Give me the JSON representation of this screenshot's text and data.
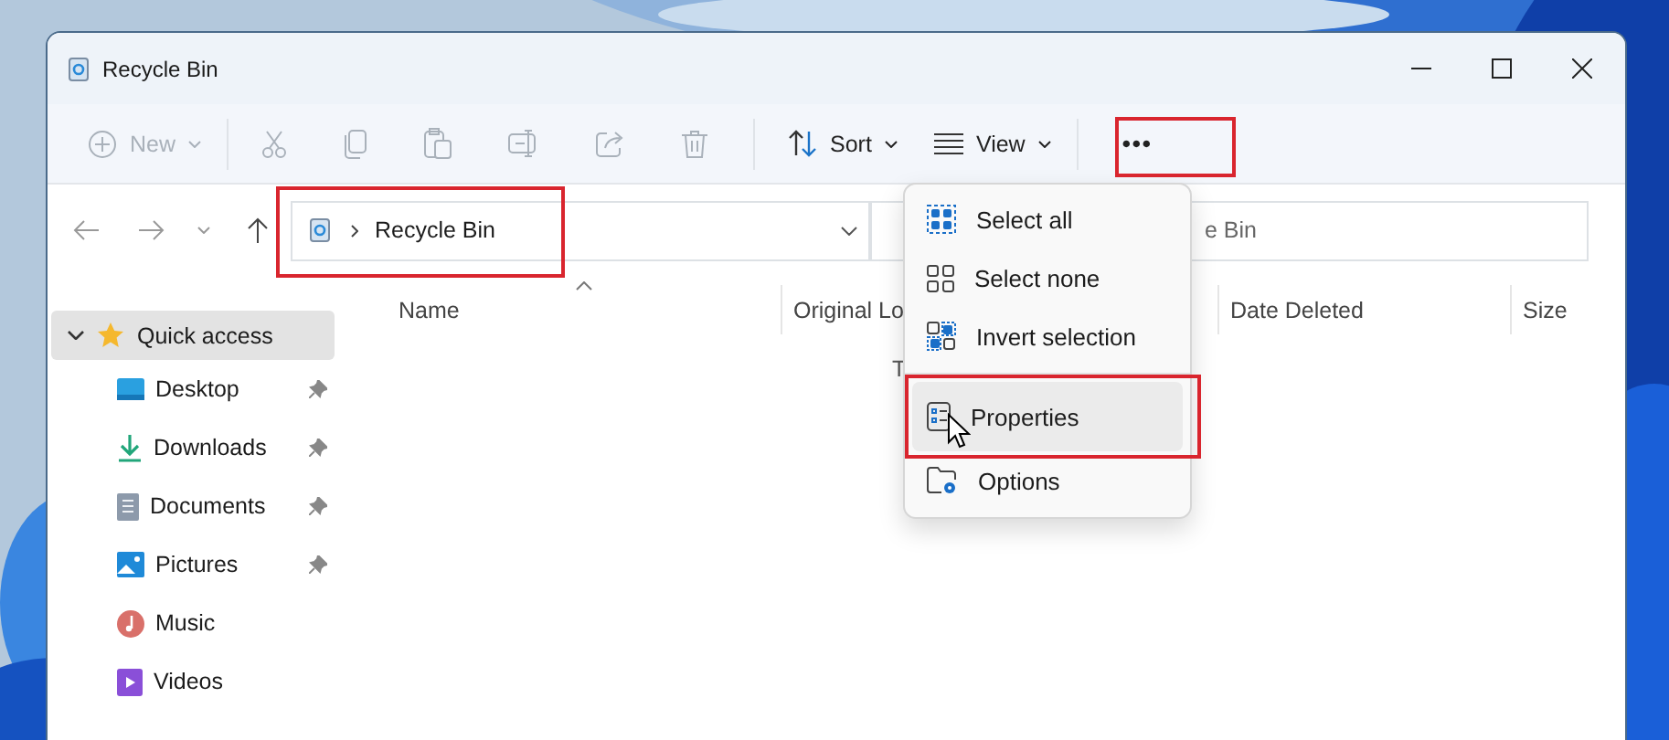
{
  "window": {
    "title": "Recycle Bin"
  },
  "toolbar": [
    {
      "label": "New",
      "disabled": true
    },
    {
      "disabled": true
    },
    {
      "disabled": true
    },
    {
      "disabled": true
    },
    {
      "disabled": true
    },
    {
      "disabled": true
    },
    {
      "disabled": true
    },
    {
      "label": "Sort",
      "disabled": false
    },
    {
      "label": "View",
      "disabled": false
    },
    {
      "label": "•••",
      "disabled": false,
      "highlighted": true
    }
  ],
  "address_bar": {
    "path": "Recycle Bin",
    "highlighted": true
  },
  "search": {
    "placeholder": "e Bin"
  },
  "columns": [
    {
      "label": "Name",
      "sorted": true
    },
    {
      "label": "Original Lo"
    },
    {
      "label": "Date Deleted"
    },
    {
      "label": "Size"
    }
  ],
  "empty_message": "T",
  "sidebar": {
    "items": [
      {
        "label": "Quick access",
        "selected": true,
        "expanded": true,
        "children": [
          {
            "label": "Desktop",
            "selected": false,
            "pinned": true
          },
          {
            "label": "Downloads",
            "selected": false,
            "pinned": true
          },
          {
            "label": "Documents",
            "selected": false,
            "pinned": true
          },
          {
            "label": "Pictures",
            "selected": false,
            "pinned": true
          },
          {
            "label": "Music",
            "selected": false,
            "pinned": false
          },
          {
            "label": "Videos",
            "selected": false,
            "pinned": false
          }
        ]
      }
    ]
  },
  "menu": {
    "items": [
      {
        "label": "Select all",
        "hovered": false,
        "highlighted": false
      },
      {
        "label": "Select none",
        "hovered": false,
        "highlighted": false
      },
      {
        "label": "Invert selection",
        "hovered": false,
        "highlighted": false
      },
      {
        "label": "Properties",
        "hovered": true,
        "highlighted": true
      },
      {
        "label": "Options",
        "hovered": false,
        "highlighted": false
      }
    ]
  }
}
